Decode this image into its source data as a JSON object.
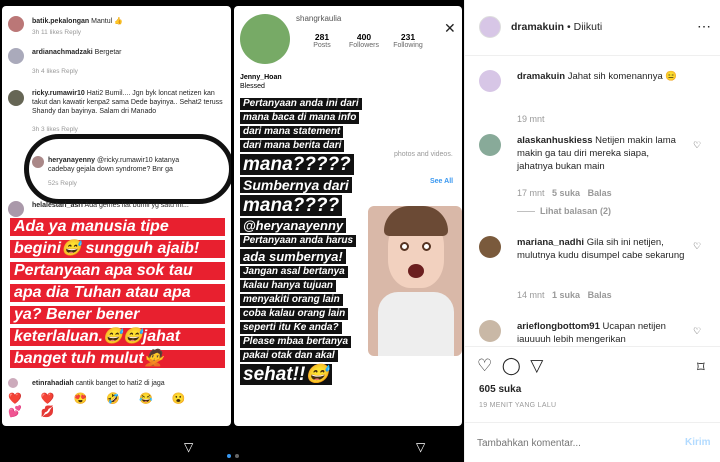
{
  "story1": {
    "comments": [
      {
        "user": "batik.pekalongan",
        "text": "Mantul 👍",
        "meta": "3h  11 likes  Reply"
      },
      {
        "user": "ardianachmadzaki",
        "text": "Bergetar",
        "meta": "3h   4 likes   Reply"
      },
      {
        "user": "ricky.rumawir10",
        "text": "Hati2 Bumil.... Jgn byk loncat netizen kan takut dan kawatir kenpa2 sama Dede bayinya.. Sehat2 teruss Shandy dan bayinya. Salam dri Manado",
        "meta": "3h  3 likes  Reply"
      },
      {
        "user": "heryanayenny",
        "text": "@ricky.rumawir10 katanya cadebay gejala down syndrome? Bnr ga",
        "meta": "52s   Reply"
      },
      {
        "user": "helalestari_asri",
        "text": "Ada gemes liat bumil yg satu ini...",
        "meta": ""
      }
    ],
    "red_lines": [
      "Ada ya manusia tipe",
      "begini😅 sungguh ajaib!",
      "Pertanyaan apa sok tau",
      "apa dia Tuhan atau apa",
      "ya? Bener bener",
      "keterlaluan.😅😅jahat",
      "banget tuh mulut🙅"
    ],
    "last_comment": {
      "user": "etinrahadiah",
      "text": "cantik banget to hati2 di jaga"
    },
    "emojis": "❤️ ❤️ 😍 🤣 😂 😮 💕 💋"
  },
  "story2": {
    "profile": {
      "name": "shangrkaulia",
      "posts": "281",
      "posts_label": "Posts",
      "followers": "400",
      "followers_label": "Followers",
      "following": "231",
      "following_label": "Following",
      "bio_name": "Jenny_Hoan",
      "bio": "Blessed",
      "see_all": "See All",
      "photos_text": "photos and videos."
    },
    "lines": [
      {
        "t": "Pertanyaan anda ini dari",
        "s": 10
      },
      {
        "t": "mana baca di mana info",
        "s": 10
      },
      {
        "t": "dari mana statement",
        "s": 10
      },
      {
        "t": "dari mana berita dari",
        "s": 10
      },
      {
        "t": "mana?????",
        "s": 19
      },
      {
        "t": "Sumbernya dari",
        "s": 14
      },
      {
        "t": "mana????",
        "s": 19
      },
      {
        "t": "@heryanayenny",
        "s": 13
      },
      {
        "t": "Pertanyaan anda harus",
        "s": 10
      },
      {
        "t": "ada sumbernya!",
        "s": 13
      },
      {
        "t": "Jangan asal bertanya",
        "s": 10
      },
      {
        "t": "kalau hanya tujuan",
        "s": 10
      },
      {
        "t": "menyakiti orang lain",
        "s": 10
      },
      {
        "t": "coba kalau orang lain",
        "s": 10
      },
      {
        "t": "seperti itu Ke anda?",
        "s": 10
      },
      {
        "t": "Please mbaa bertanya",
        "s": 10
      },
      {
        "t": "pakai otak dan akal",
        "s": 10
      },
      {
        "t": "sehat!!😅",
        "s": 19
      }
    ]
  },
  "post": {
    "username": "dramakuin",
    "follow_state": "• Diikuti",
    "caption_user": "dramakuin",
    "caption_text": "Jahat sih komenannya 😑",
    "caption_time": "19 mnt",
    "comments": [
      {
        "user": "alaskanhuskiess",
        "text": "Netijen makin lama makin ga tau diri mereka siapa, jahatnya bukan main",
        "time": "17 mnt",
        "likes": "5 suka",
        "reply": "Balas"
      },
      {
        "user": "mariana_nadhi",
        "text": "Gila sih ini netijen, mulutnya kudu disumpel cabe sekarung",
        "time": "14 mnt",
        "likes": "1 suka",
        "reply": "Balas"
      },
      {
        "user": "arieflongbottom91",
        "text": "Ucapan netijen iauuuuh lebih mengerikan"
      }
    ],
    "view_replies": "Lihat balasan (2)",
    "likes_count": "605 suka",
    "posted_ago": "19 MENIT YANG LALU",
    "add_comment_placeholder": "Tambahkan komentar...",
    "post_button": "Kirim"
  },
  "colors": {
    "story_red": "#e8202f",
    "link_blue": "#3897f0"
  }
}
